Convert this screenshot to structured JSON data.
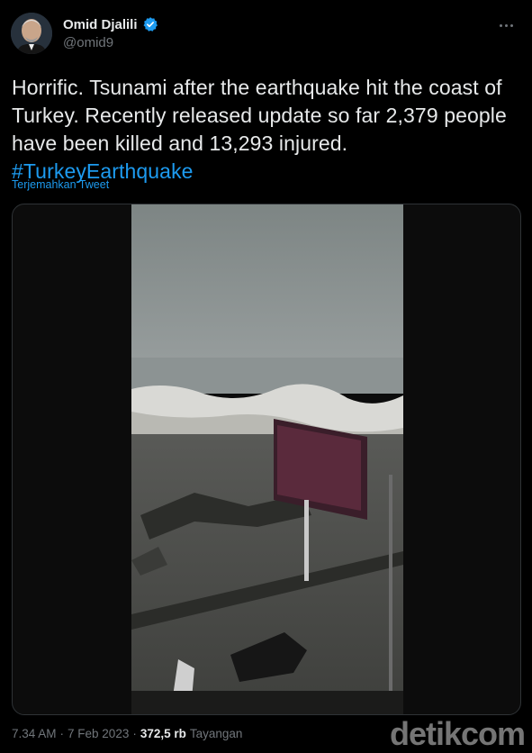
{
  "author": {
    "display_name": "Omid Djalili",
    "handle": "@omid9",
    "verified_icon": "verified-badge-icon"
  },
  "tweet": {
    "text": "Horrific. Tsunami after the earthquake hit the coast of Turkey. Recently released update so far 2,379 people have been killed and 13,293 injured.",
    "hashtag": "#TurkeyEarthquake",
    "translate_label": "Terjemahkan Tweet"
  },
  "footer": {
    "time": "7.34 AM",
    "separator1": "·",
    "date": "7 Feb 2023",
    "separator2": "·",
    "views": "372,5 rb",
    "views_label": "Tayangan"
  },
  "watermark": "detikcom",
  "colors": {
    "background": "#000000",
    "text": "#e7e9ea",
    "secondary": "#71767b",
    "accent": "#1d9bf0",
    "border": "#2f3336"
  }
}
